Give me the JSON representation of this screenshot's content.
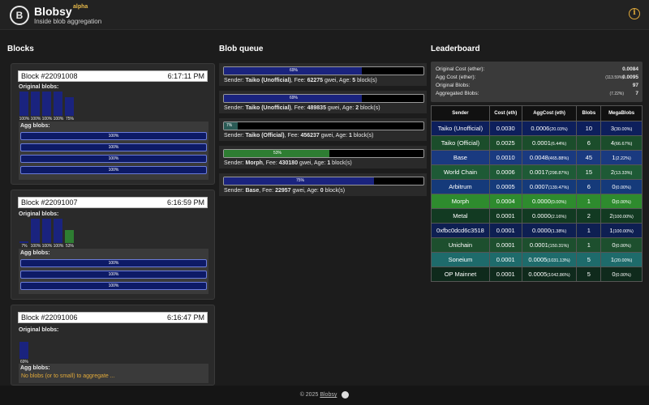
{
  "header": {
    "title": "Blobsy",
    "badge": "alpha",
    "tagline": "Inside blob aggregation",
    "logo_letter": "B",
    "info_symbol": "i",
    "info_icon": "info-circle-icon"
  },
  "columns": {
    "blocks": "Blocks",
    "queue": "Blob queue",
    "leaderboard": "Leaderboard"
  },
  "labels": {
    "original_blobs": "Original blobs:",
    "agg_blobs": "Agg blobs:"
  },
  "blocks": [
    {
      "number": "Block #22091008",
      "time": "6:17:11 PM",
      "original": [
        {
          "pct": "100%",
          "value": 1.0,
          "color": "#1a237e"
        },
        {
          "pct": "100%",
          "value": 1.0,
          "color": "#1a237e"
        },
        {
          "pct": "100%",
          "value": 1.0,
          "color": "#1a237e"
        },
        {
          "pct": "100%",
          "value": 1.0,
          "color": "#1a237e"
        },
        {
          "pct": "75%",
          "value": 0.75,
          "color": "#1a237e"
        }
      ],
      "agg": [
        "100%",
        "100%",
        "100%",
        "100%"
      ],
      "empty_msg": ""
    },
    {
      "number": "Block #22091007",
      "time": "6:16:59 PM",
      "original": [
        {
          "pct": "7%",
          "value": 0.07,
          "color": "#1a237e"
        },
        {
          "pct": "100%",
          "value": 1.0,
          "color": "#1a237e"
        },
        {
          "pct": "100%",
          "value": 1.0,
          "color": "#1a237e"
        },
        {
          "pct": "100%",
          "value": 1.0,
          "color": "#1a237e"
        },
        {
          "pct": "53%",
          "value": 0.53,
          "color": "#2e7d32"
        }
      ],
      "agg": [
        "100%",
        "100%",
        "100%"
      ],
      "empty_msg": ""
    },
    {
      "number": "Block #22091006",
      "time": "6:16:47 PM",
      "original": [
        {
          "pct": "69%",
          "value": 0.69,
          "color": "#1a237e"
        }
      ],
      "agg": [],
      "empty_msg": "No blobs (or to small) to aggregate ..."
    }
  ],
  "queue": [
    {
      "pct": "69%",
      "fill": 0.69,
      "style": "blue",
      "sender": "Taiko (Unofficial)",
      "fee": "62275",
      "age": "5"
    },
    {
      "pct": "69%",
      "fill": 0.69,
      "style": "blue",
      "sender": "Taiko (Unofficial)",
      "fee": "489835",
      "age": "2"
    },
    {
      "pct": "7%",
      "fill": 0.07,
      "style": "teal",
      "sender": "Taiko (Official)",
      "fee": "456237",
      "age": "1"
    },
    {
      "pct": "53%",
      "fill": 0.53,
      "style": "green",
      "sender": "Morph",
      "fee": "430180",
      "age": "1"
    },
    {
      "pct": "75%",
      "fill": 0.75,
      "style": "blue",
      "sender": "Base",
      "fee": "22957",
      "age": "0"
    }
  ],
  "queue_text": {
    "sender": "Sender:",
    "fee": "Fee:",
    "gwei": "gwei, Age:",
    "blocks": "block(s)"
  },
  "summary": [
    {
      "key": "Original Cost (ether):",
      "pct": "",
      "value": "0.0084"
    },
    {
      "key": "Agg Cost (ether):",
      "pct": "(113.59%)",
      "value": "0.0095"
    },
    {
      "key": "Original Blobs:",
      "pct": "",
      "value": "97"
    },
    {
      "key": "Aggregated Blobs:",
      "pct": "(7.22%)",
      "value": "7"
    }
  ],
  "table": {
    "headers": [
      "Sender",
      "Cost (eth)",
      "AggCost (eth)",
      "Blobs",
      "MegaBlobs"
    ],
    "rows": [
      {
        "sender": "Taiko (Unofficial)",
        "cost": "0.0030",
        "agg": "0.0006",
        "agg_pct": "(20.03%)",
        "blobs": "10",
        "mega": "3",
        "mega_pct": "(30.00%)",
        "color": "#0d1f5c"
      },
      {
        "sender": "Taiko (Official)",
        "cost": "0.0025",
        "agg": "0.0001",
        "agg_pct": "(6.44%)",
        "blobs": "6",
        "mega": "4",
        "mega_pct": "(66.67%)",
        "color": "#1b4d2b"
      },
      {
        "sender": "Base",
        "cost": "0.0010",
        "agg": "0.0048",
        "agg_pct": "(465.88%)",
        "blobs": "45",
        "mega": "1",
        "mega_pct": "(2.22%)",
        "color": "#1a3a80"
      },
      {
        "sender": "World Chain",
        "cost": "0.0006",
        "agg": "0.0017",
        "agg_pct": "(298.87%)",
        "blobs": "15",
        "mega": "2",
        "mega_pct": "(13.33%)",
        "color": "#1e5a36"
      },
      {
        "sender": "Arbitrum",
        "cost": "0.0005",
        "agg": "0.0007",
        "agg_pct": "(139.47%)",
        "blobs": "6",
        "mega": "0",
        "mega_pct": "(0.00%)",
        "color": "#153a7a"
      },
      {
        "sender": "Morph",
        "cost": "0.0004",
        "agg": "0.0000",
        "agg_pct": "(0.00%)",
        "blobs": "1",
        "mega": "0",
        "mega_pct": "(0.00%)",
        "color": "#2e8b2e"
      },
      {
        "sender": "Metal",
        "cost": "0.0001",
        "agg": "0.0000",
        "agg_pct": "(2.16%)",
        "blobs": "2",
        "mega": "2",
        "mega_pct": "(100.00%)",
        "color": "#123a22"
      },
      {
        "sender": "0xfbc0dcd6c3518",
        "cost": "0.0001",
        "agg": "0.0000",
        "agg_pct": "(1.38%)",
        "blobs": "1",
        "mega": "1",
        "mega_pct": "(100.00%)",
        "color": "#0e1f52"
      },
      {
        "sender": "Unichain",
        "cost": "0.0001",
        "agg": "0.0001",
        "agg_pct": "(150.31%)",
        "blobs": "1",
        "mega": "0",
        "mega_pct": "(0.00%)",
        "color": "#1d4f2e"
      },
      {
        "sender": "Soneium",
        "cost": "0.0001",
        "agg": "0.0005",
        "agg_pct": "(1031.13%)",
        "blobs": "5",
        "mega": "1",
        "mega_pct": "(20.00%)",
        "color": "#1e6b6b"
      },
      {
        "sender": "OP Mainnet",
        "cost": "0.0001",
        "agg": "0.0005",
        "agg_pct": "(1042.86%)",
        "blobs": "5",
        "mega": "0",
        "mega_pct": "(0.00%)",
        "color": "#0f2a1c"
      }
    ]
  },
  "footer": {
    "copyright": "© 2025",
    "link": "Blobsy",
    "github_icon": "github-icon"
  }
}
